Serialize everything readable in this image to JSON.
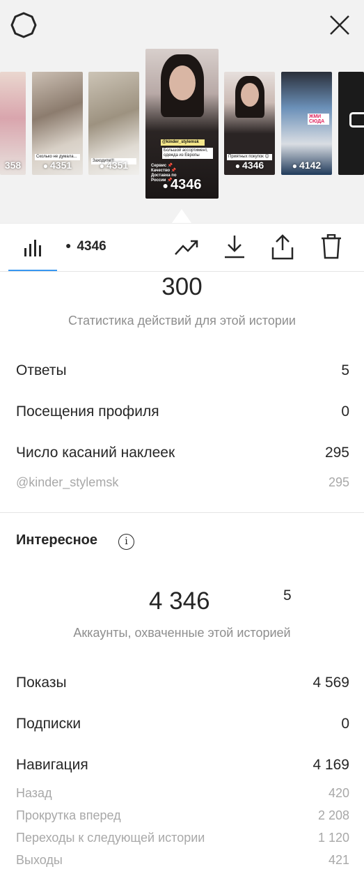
{
  "header": {
    "icons": [
      "gear-icon",
      "close-icon"
    ]
  },
  "stories": [
    {
      "views": "358",
      "caption": ""
    },
    {
      "views": "4351",
      "caption": "Сколько не думала..."
    },
    {
      "views": "4351",
      "caption": "Заходите!!!"
    },
    {
      "views": "4346",
      "caption_tag": "@kinder_stylemsk",
      "caption": "Большой ассортимент, одежда из Европы",
      "caption2": "Сервис 📌 Качество 📌 Доставка по России 📌"
    },
    {
      "views": "4346",
      "caption": "Приятных покупок 😊"
    },
    {
      "views": "4142",
      "caption": "ЖМИ СЮДА"
    }
  ],
  "toolbar": {
    "views": "4346",
    "icons": [
      "bar-chart-icon",
      "eye-icon",
      "trending-icon",
      "download-icon",
      "share-icon",
      "trash-icon"
    ]
  },
  "actions": {
    "total": "300",
    "subtitle": "Статистика действий для этой истории",
    "rows": [
      {
        "label": "Ответы",
        "value": "5"
      },
      {
        "label": "Посещения профиля",
        "value": "0"
      },
      {
        "label": "Число касаний наклеек",
        "value": "295"
      },
      {
        "label": "@kinder_stylemsk",
        "value": "295"
      }
    ]
  },
  "discovery": {
    "title": "Интересное",
    "reach": "4 346",
    "reach_sup": "5",
    "subtitle": "Аккаунты, охваченные этой историей",
    "rows": [
      {
        "label": "Показы",
        "value": "4 569"
      },
      {
        "label": "Подписки",
        "value": "0"
      },
      {
        "label": "Навигация",
        "value": "4 169"
      },
      {
        "label": "Назад",
        "value": "420"
      },
      {
        "label": "Прокрутка вперед",
        "value": "2 208"
      },
      {
        "label": "Переходы к следующей истории",
        "value": "1 120"
      },
      {
        "label": "Выходы",
        "value": "421"
      }
    ]
  },
  "colors": {
    "accent": "#3897f0",
    "text": "#262626",
    "muted": "#8e8e8e"
  }
}
